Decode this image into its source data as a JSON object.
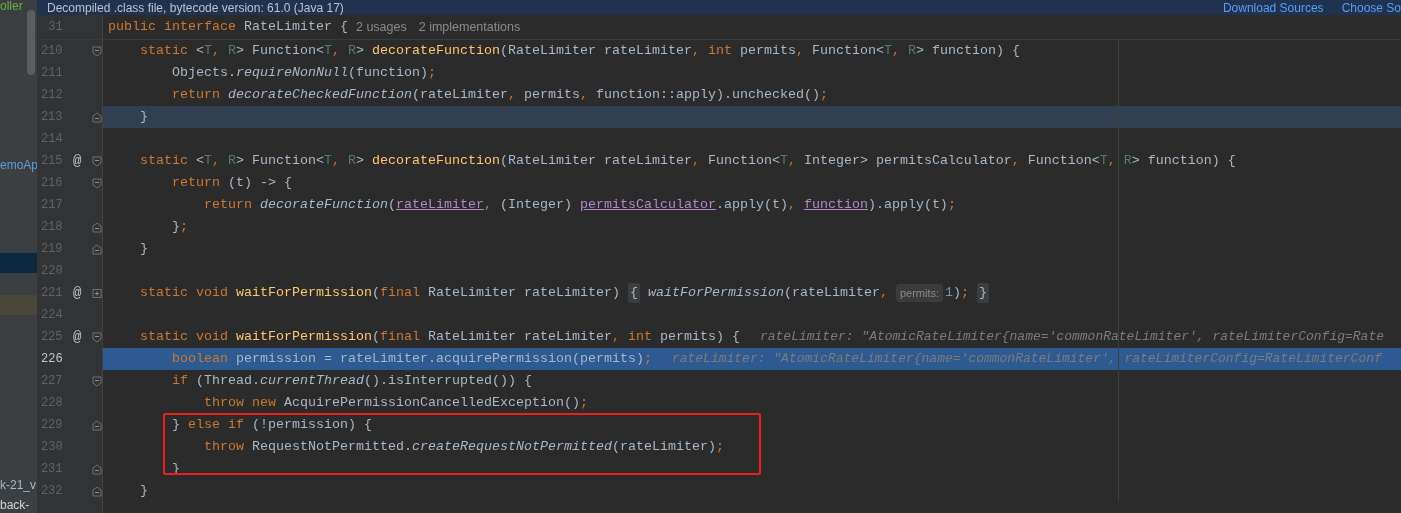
{
  "banner": {
    "text": "Decompiled .class file, bytecode version: 61.0 (Java 17)",
    "links": [
      "Download Sources",
      "Choose So"
    ]
  },
  "sidebar": {
    "items": [
      {
        "kind": "file",
        "text": "oller",
        "color": "#62b543"
      },
      {
        "kind": "file",
        "text": "emoAp",
        "color": "#5c9ce0"
      },
      {
        "kind": "selected"
      },
      {
        "kind": "marked"
      },
      {
        "kind": "file",
        "text": "k-21_v",
        "color": "#a9b7c6"
      },
      {
        "kind": "file",
        "text": "back-",
        "color": "#d4d4d4"
      }
    ]
  },
  "header": {
    "number": "31",
    "tokens": [
      {
        "kind": "kw",
        "text": "public interface "
      },
      {
        "kind": "plain",
        "text": "RateLimiter {"
      }
    ],
    "hints": [
      "2 usages",
      "2 implementations"
    ]
  },
  "lines": [
    {
      "number": "210",
      "fold": {
        "kind": "open"
      },
      "tokens": [
        {
          "kind": "kw",
          "text": "    static "
        },
        {
          "kind": "plain",
          "text": "<"
        },
        {
          "kind": "tparam",
          "text": "T"
        },
        {
          "kind": "punct",
          "text": ", "
        },
        {
          "kind": "tparam",
          "text": "R"
        },
        {
          "kind": "plain",
          "text": "> Function<"
        },
        {
          "kind": "tparam",
          "text": "T"
        },
        {
          "kind": "punct",
          "text": ", "
        },
        {
          "kind": "tparam",
          "text": "R"
        },
        {
          "kind": "plain",
          "text": "> "
        },
        {
          "kind": "decl",
          "text": "decorateFunction"
        },
        {
          "kind": "plain",
          "text": "(RateLimiter rateLimiter"
        },
        {
          "kind": "punct",
          "text": ", "
        },
        {
          "kind": "kw",
          "text": "int "
        },
        {
          "kind": "plain",
          "text": "permits"
        },
        {
          "kind": "punct",
          "text": ", "
        },
        {
          "kind": "plain",
          "text": "Function<"
        },
        {
          "kind": "tparam",
          "text": "T"
        },
        {
          "kind": "punct",
          "text": ", "
        },
        {
          "kind": "tparam",
          "text": "R"
        },
        {
          "kind": "plain",
          "text": "> function) {"
        }
      ]
    },
    {
      "number": "211",
      "tokens": [
        {
          "kind": "plain",
          "text": "        Objects."
        },
        {
          "kind": "italic",
          "text": "requireNonNull"
        },
        {
          "kind": "plain",
          "text": "(function)"
        },
        {
          "kind": "punct",
          "text": ";"
        }
      ]
    },
    {
      "number": "212",
      "tokens": [
        {
          "kind": "kw",
          "text": "        return "
        },
        {
          "kind": "italic",
          "text": "decorateCheckedFunction"
        },
        {
          "kind": "plain",
          "text": "(rateLimiter"
        },
        {
          "kind": "punct",
          "text": ", "
        },
        {
          "kind": "plain",
          "text": "permits"
        },
        {
          "kind": "punct",
          "text": ", "
        },
        {
          "kind": "plain",
          "text": "function::apply).unchecked()"
        },
        {
          "kind": "punct",
          "text": ";"
        }
      ]
    },
    {
      "number": "213",
      "fold": {
        "kind": "close"
      },
      "highlight": {
        "kind": "caret"
      },
      "tokens": [
        {
          "kind": "plain",
          "text": "    }"
        }
      ]
    },
    {
      "number": "214"
    },
    {
      "number": "215",
      "marker": "@",
      "fold": {
        "kind": "open"
      },
      "tokens": [
        {
          "kind": "kw",
          "text": "    static "
        },
        {
          "kind": "plain",
          "text": "<"
        },
        {
          "kind": "tparam",
          "text": "T"
        },
        {
          "kind": "punct",
          "text": ", "
        },
        {
          "kind": "tparam",
          "text": "R"
        },
        {
          "kind": "plain",
          "text": "> Function<"
        },
        {
          "kind": "tparam",
          "text": "T"
        },
        {
          "kind": "punct",
          "text": ", "
        },
        {
          "kind": "tparam",
          "text": "R"
        },
        {
          "kind": "plain",
          "text": "> "
        },
        {
          "kind": "decl",
          "text": "decorateFunction"
        },
        {
          "kind": "plain",
          "text": "(RateLimiter rateLimiter"
        },
        {
          "kind": "punct",
          "text": ", "
        },
        {
          "kind": "plain",
          "text": "Function<"
        },
        {
          "kind": "tparam",
          "text": "T"
        },
        {
          "kind": "punct",
          "text": ", "
        },
        {
          "kind": "plain",
          "text": "Integer> permitsCalculator"
        },
        {
          "kind": "punct",
          "text": ", "
        },
        {
          "kind": "plain",
          "text": "Function<"
        },
        {
          "kind": "tparam",
          "text": "T"
        },
        {
          "kind": "punct",
          "text": ", "
        },
        {
          "kind": "tparam",
          "text": "R"
        },
        {
          "kind": "plain",
          "text": "> function) {"
        }
      ]
    },
    {
      "number": "216",
      "fold": {
        "kind": "open"
      },
      "tokens": [
        {
          "kind": "kw",
          "text": "        return "
        },
        {
          "kind": "plain",
          "text": "(t) -> {"
        }
      ]
    },
    {
      "number": "217",
      "tokens": [
        {
          "kind": "kw",
          "text": "            return "
        },
        {
          "kind": "italic",
          "text": "decorateFunction"
        },
        {
          "kind": "plain",
          "text": "("
        },
        {
          "kind": "link",
          "text": "rateLimiter"
        },
        {
          "kind": "punct",
          "text": ", "
        },
        {
          "kind": "plain",
          "text": "(Integer) "
        },
        {
          "kind": "link",
          "text": "permitsCalculator"
        },
        {
          "kind": "plain",
          "text": ".apply(t)"
        },
        {
          "kind": "punct",
          "text": ", "
        },
        {
          "kind": "link",
          "text": "function"
        },
        {
          "kind": "plain",
          "text": ").apply(t)"
        },
        {
          "kind": "punct",
          "text": ";"
        }
      ]
    },
    {
      "number": "218",
      "fold": {
        "kind": "close"
      },
      "tokens": [
        {
          "kind": "plain",
          "text": "        }"
        },
        {
          "kind": "punct",
          "text": ";"
        }
      ]
    },
    {
      "number": "219",
      "fold": {
        "kind": "close"
      },
      "tokens": [
        {
          "kind": "plain",
          "text": "    }"
        }
      ]
    },
    {
      "number": "220"
    },
    {
      "number": "221",
      "marker": "@",
      "fold": {
        "kind": "collapsed"
      },
      "tokens": [
        {
          "kind": "kw",
          "text": "    static void "
        },
        {
          "kind": "decl",
          "text": "waitForPermission"
        },
        {
          "kind": "plain",
          "text": "("
        },
        {
          "kind": "kw",
          "text": "final "
        },
        {
          "kind": "plain",
          "text": "RateLimiter rateLimiter) "
        },
        {
          "kind": "folded",
          "text": "{"
        },
        {
          "kind": "italic",
          "text": " waitForPermission"
        },
        {
          "kind": "plain",
          "text": "(rateLimiter"
        },
        {
          "kind": "punct",
          "text": ", "
        },
        {
          "kind": "inlay",
          "text": "permits:"
        },
        {
          "kind": "num",
          "text": "1"
        },
        {
          "kind": "plain",
          "text": ")"
        },
        {
          "kind": "punct",
          "text": "; "
        },
        {
          "kind": "folded",
          "text": "}"
        }
      ]
    },
    {
      "number": "224"
    },
    {
      "number": "225",
      "marker": "@",
      "fold": {
        "kind": "open"
      },
      "tokens": [
        {
          "kind": "kw",
          "text": "    static void "
        },
        {
          "kind": "decl",
          "text": "waitForPermission"
        },
        {
          "kind": "plain",
          "text": "("
        },
        {
          "kind": "kw",
          "text": "final "
        },
        {
          "kind": "plain",
          "text": "RateLimiter rateLimiter"
        },
        {
          "kind": "punct",
          "text": ", "
        },
        {
          "kind": "kw",
          "text": "int "
        },
        {
          "kind": "plain",
          "text": "permits) {"
        },
        {
          "kind": "value",
          "text": "rateLimiter: \"AtomicRateLimiter{name='commonRateLimiter', rateLimiterConfig=Rate"
        }
      ]
    },
    {
      "number": "226",
      "highlight": {
        "kind": "execution"
      },
      "tokens": [
        {
          "kind": "kw",
          "text": "        boolean "
        },
        {
          "kind": "plain",
          "text": "permission = rateLimiter.acquirePermission(permits)"
        },
        {
          "kind": "punct",
          "text": ";"
        },
        {
          "kind": "value",
          "text": "rateLimiter: \"AtomicRateLimiter{name='commonRateLimiter', rateLimiterConfig=RateLimiterConf"
        }
      ]
    },
    {
      "number": "227",
      "fold": {
        "kind": "open"
      },
      "tokens": [
        {
          "kind": "kw",
          "text": "        if "
        },
        {
          "kind": "plain",
          "text": "(Thread."
        },
        {
          "kind": "italic",
          "text": "currentThread"
        },
        {
          "kind": "plain",
          "text": "().isInterrupted()) {"
        }
      ]
    },
    {
      "number": "228",
      "tokens": [
        {
          "kind": "kw",
          "text": "            throw new "
        },
        {
          "kind": "plain",
          "text": "AcquirePermissionCancelledException()"
        },
        {
          "kind": "punct",
          "text": ";"
        }
      ]
    },
    {
      "number": "229",
      "fold": {
        "kind": "close"
      },
      "tokens": [
        {
          "kind": "plain",
          "text": "        } "
        },
        {
          "kind": "kw",
          "text": "else if "
        },
        {
          "kind": "plain",
          "text": "(!permission) {"
        }
      ]
    },
    {
      "number": "230",
      "tokens": [
        {
          "kind": "kw",
          "text": "            throw "
        },
        {
          "kind": "plain",
          "text": "RequestNotPermitted."
        },
        {
          "kind": "italic",
          "text": "createRequestNotPermitted"
        },
        {
          "kind": "plain",
          "text": "(rateLimiter)"
        },
        {
          "kind": "punct",
          "text": ";"
        }
      ]
    },
    {
      "number": "231",
      "fold": {
        "kind": "close"
      },
      "tokens": [
        {
          "kind": "plain",
          "text": "        }"
        }
      ]
    },
    {
      "number": "232",
      "fold": {
        "kind": "close"
      },
      "tokens": [
        {
          "kind": "plain",
          "text": "    }"
        }
      ]
    }
  ]
}
